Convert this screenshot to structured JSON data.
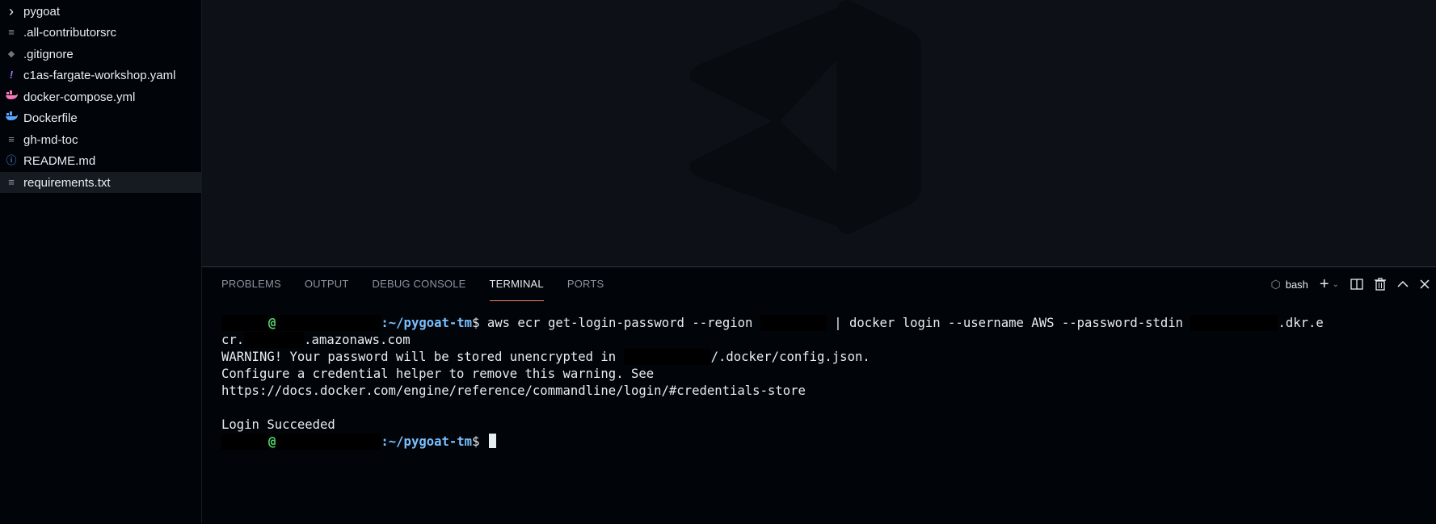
{
  "explorer": {
    "items": [
      {
        "label": "pygoat",
        "icon": "chevron-right-icon",
        "glyph": "›",
        "color": "#e6edf3"
      },
      {
        "label": ".all-contributorsrc",
        "icon": "text-file-icon",
        "glyph": "≡",
        "color": "#8b949e"
      },
      {
        "label": ".gitignore",
        "icon": "git-file-icon",
        "glyph": "◆",
        "color": "#6e7681"
      },
      {
        "label": "c1as-fargate-workshop.yaml",
        "icon": "yaml-file-icon",
        "glyph": "!",
        "color": "#a371f7"
      },
      {
        "label": "docker-compose.yml",
        "icon": "docker-compose-icon",
        "glyph": "🐳",
        "color": "#f778ba"
      },
      {
        "label": "Dockerfile",
        "icon": "docker-icon",
        "glyph": "🐳",
        "color": "#58a6ff"
      },
      {
        "label": "gh-md-toc",
        "icon": "text-file-icon",
        "glyph": "≡",
        "color": "#8b949e"
      },
      {
        "label": "README.md",
        "icon": "info-icon",
        "glyph": "ⓘ",
        "color": "#58a6ff"
      },
      {
        "label": "requirements.txt",
        "icon": "text-file-icon",
        "glyph": "≡",
        "color": "#8b949e"
      }
    ],
    "selected": "requirements.txt"
  },
  "panel": {
    "tabs": [
      "PROBLEMS",
      "OUTPUT",
      "DEBUG CONSOLE",
      "TERMINAL",
      "PORTS"
    ],
    "active_tab": "TERMINAL",
    "shell_label": "bash"
  },
  "terminal": {
    "at": "@",
    "path": ":~/pygoat-tm",
    "prompt_symbol": "$",
    "cmd_part1": " aws ecr get-login-password --region ",
    "cmd_part2": " | docker login --username AWS --password-stdin ",
    "cmd_part3": ".dkr.e",
    "cmd_cont1": "cr.",
    "cmd_cont2": ".amazonaws.com",
    "warn_pre": "WARNING! Your password will be stored unencrypted in ",
    "warn_post": "/.docker/config.json.",
    "line_configure": "Configure a credential helper to remove this warning. See",
    "line_url": "https://docs.docker.com/engine/reference/commandline/login/#credentials-store",
    "line_success": "Login Succeeded"
  },
  "colors": {
    "accent_tab_underline": "#f78166",
    "prompt_user": "#56d364",
    "prompt_path": "#79c0ff"
  }
}
